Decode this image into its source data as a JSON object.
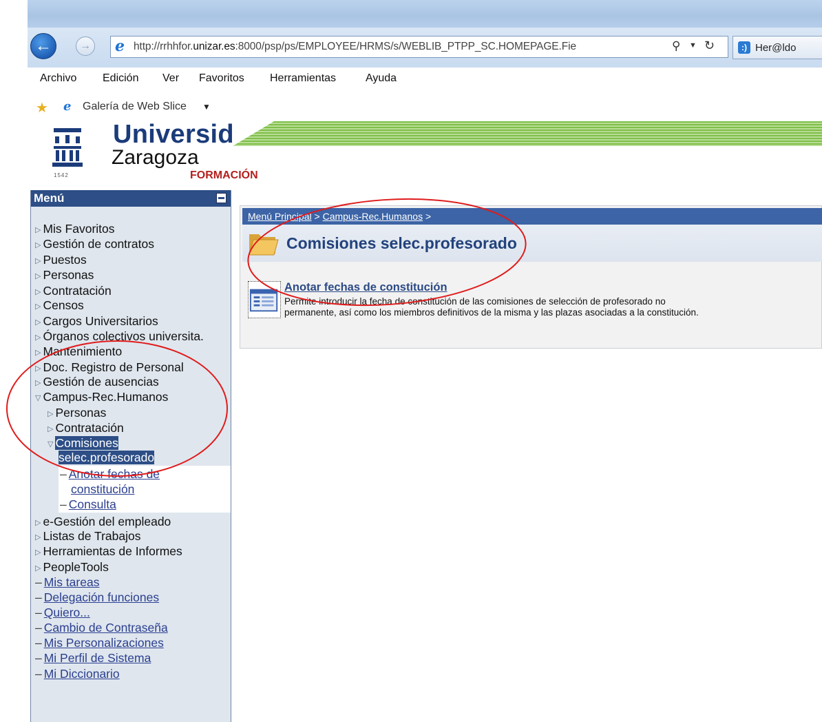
{
  "browser": {
    "url_prefix": "http://rrhhfor.",
    "url_domain": "unizar.es",
    "url_suffix": ":8000/psp/ps/EMPLOYEE/HRMS/s/WEBLIB_PTPP_SC.HOMEPAGE.Fie",
    "tab_label": "Her@ldo",
    "menu": [
      "Archivo",
      "Edición",
      "Ver",
      "Favoritos",
      "Herramientas",
      "Ayuda"
    ],
    "favorites_gallery": "Galería de Web Slice"
  },
  "header": {
    "university": "Universid",
    "city": "Zaragoza",
    "year": "1542",
    "subtitle": "FORMACIÓN"
  },
  "menu": {
    "title": "Menú",
    "items": [
      {
        "label": "Mis Favoritos"
      },
      {
        "label": "Gestión de contratos"
      },
      {
        "label": "Puestos"
      },
      {
        "label": "Personas"
      },
      {
        "label": "Contratación"
      },
      {
        "label": "Censos"
      },
      {
        "label": "Cargos Universitarios"
      },
      {
        "label": "Órganos colectivos universita."
      },
      {
        "label": "Mantenimiento"
      },
      {
        "label": "Doc. Registro de Personal"
      },
      {
        "label": "Gestión de ausencias"
      },
      {
        "label": "Campus-Rec.Humanos"
      }
    ],
    "sub_items": [
      {
        "label": "Personas"
      },
      {
        "label": "Contratación"
      },
      {
        "label": "Comisiones"
      },
      {
        "label": "selec.profesorado"
      }
    ],
    "sub_links": [
      {
        "label": "Anotar fechas de"
      },
      {
        "label": "constitución"
      },
      {
        "label": "Consulta"
      }
    ],
    "more_items": [
      {
        "label": "e-Gestión del empleado"
      },
      {
        "label": "Listas de Trabajos"
      },
      {
        "label": "Herramientas de Informes"
      },
      {
        "label": "PeopleTools"
      }
    ],
    "links": [
      {
        "label": "Mis tareas"
      },
      {
        "label": "Delegación funciones"
      },
      {
        "label": "Quiero..."
      },
      {
        "label": "Cambio de Contraseña"
      },
      {
        "label": "Mis Personalizaciones"
      },
      {
        "label": "Mi Perfil de Sistema"
      },
      {
        "label": "Mi Diccionario"
      }
    ]
  },
  "content": {
    "breadcrumb_1": "Menú Principal",
    "breadcrumb_sep": ">",
    "breadcrumb_2": "Campus-Rec.Humanos",
    "breadcrumb_end": ">",
    "title": "Comisiones selec.profesorado",
    "item_title": "Anotar fechas de constitución",
    "item_desc_1": "Permite introducir la fecha de constitución de las comisiones de selección de profesorado no",
    "item_desc_2": "permanente, así como los miembros definitivos de la misma y las plazas asociadas a la constitución."
  },
  "colors": {
    "menu_header": "#2d4e86",
    "breadcrumb_bar": "#3c64a6",
    "annotation": "#e01b1b",
    "formacion": "#b3201e"
  }
}
